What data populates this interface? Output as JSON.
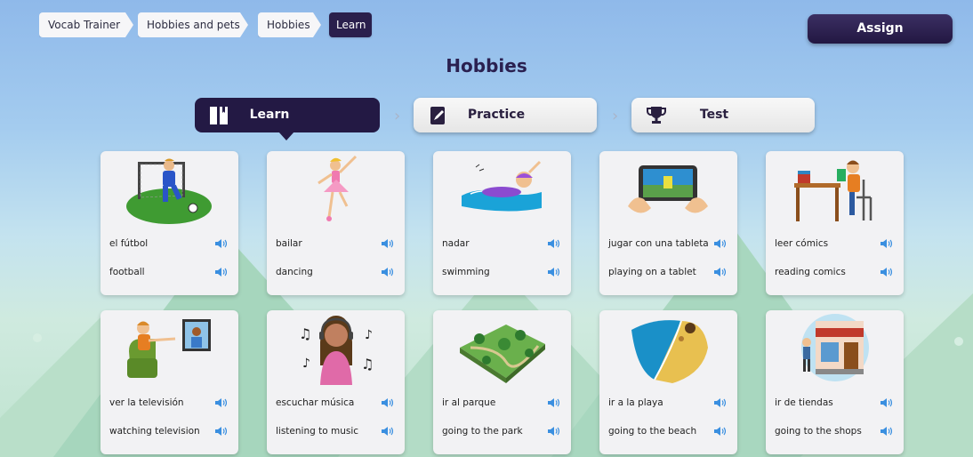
{
  "breadcrumb": [
    "Vocab Trainer",
    "Hobbies and pets",
    "Hobbies",
    "Learn"
  ],
  "assign_label": "Assign",
  "title": "Hobbies",
  "modes": {
    "learn": {
      "label": "Learn",
      "icon": "book-icon",
      "active": true
    },
    "practice": {
      "label": "Practice",
      "icon": "pencil-icon"
    },
    "test": {
      "label": "Test",
      "icon": "trophy-icon"
    }
  },
  "colors": {
    "accent": "#231944",
    "speaker": "#3a8fe0",
    "card": "#f2f2f4"
  },
  "cards": [
    {
      "word": "el fútbol",
      "translation": "football",
      "image": "football-icon"
    },
    {
      "word": "bailar",
      "translation": "dancing",
      "image": "dancer-icon"
    },
    {
      "word": "nadar",
      "translation": "swimming",
      "image": "swimmer-icon"
    },
    {
      "word": "jugar con una tableta",
      "translation": "playing on a tablet",
      "image": "tablet-icon"
    },
    {
      "word": "leer cómics",
      "translation": "reading comics",
      "image": "reading-icon"
    },
    {
      "word": "ver la televisión",
      "translation": "watching television",
      "image": "tv-icon"
    },
    {
      "word": "escuchar música",
      "translation": "listening to music",
      "image": "music-icon"
    },
    {
      "word": "ir al parque",
      "translation": "going to the park",
      "image": "park-icon"
    },
    {
      "word": "ir a la playa",
      "translation": "going to the beach",
      "image": "beach-icon"
    },
    {
      "word": "ir de tiendas",
      "translation": "going to the shops",
      "image": "shops-icon"
    }
  ]
}
